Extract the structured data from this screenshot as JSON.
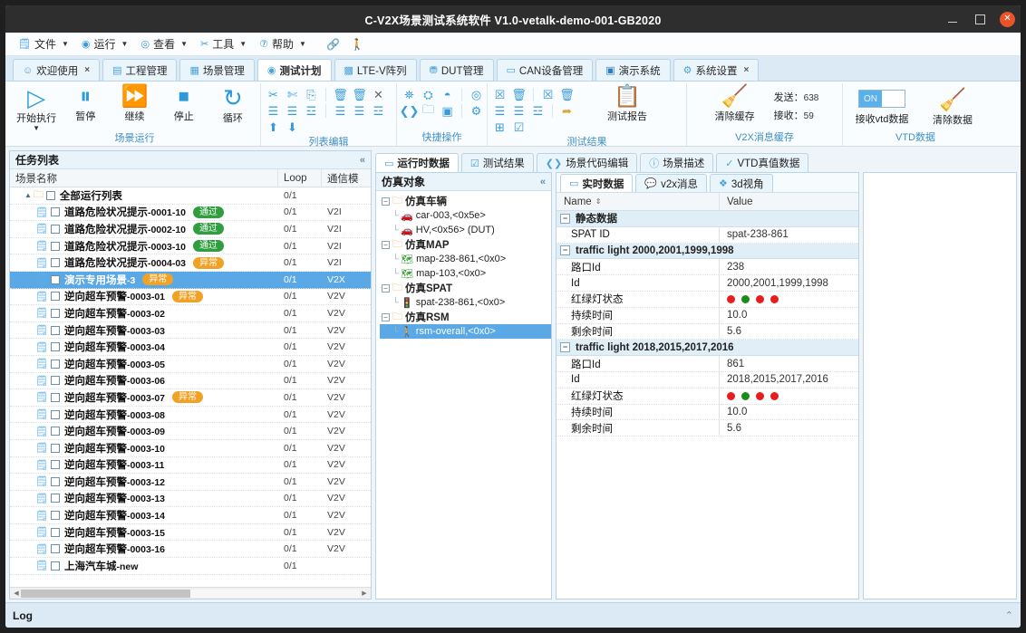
{
  "window": {
    "title": "C-V2X场景测试系统软件 V1.0-vetalk-demo-001-GB2020",
    "minimize": "—",
    "maximize": "□",
    "close": "✕"
  },
  "menubar": {
    "items": [
      {
        "label": "文件",
        "icon": "file-icon"
      },
      {
        "label": "运行",
        "icon": "run-icon"
      },
      {
        "label": "查看",
        "icon": "view-icon"
      },
      {
        "label": "工具",
        "icon": "tools-icon"
      },
      {
        "label": "帮助",
        "icon": "help-icon"
      }
    ],
    "extra": [
      {
        "icon": "link-icon",
        "glyph": "🔗"
      },
      {
        "icon": "person-icon",
        "glyph": "🚶"
      }
    ]
  },
  "tabs": [
    {
      "label": "欢迎使用",
      "closable": true,
      "active": false,
      "icon": "smiley-icon"
    },
    {
      "label": "工程管理",
      "closable": false,
      "active": false,
      "icon": "project-icon"
    },
    {
      "label": "场景管理",
      "closable": false,
      "active": false,
      "icon": "scene-icon"
    },
    {
      "label": "测试计划",
      "closable": false,
      "active": true,
      "icon": "plan-icon"
    },
    {
      "label": "LTE-V阵列",
      "closable": false,
      "active": false,
      "icon": "grid-icon"
    },
    {
      "label": "DUT管理",
      "closable": false,
      "active": false,
      "icon": "dut-icon"
    },
    {
      "label": "CAN设备管理",
      "closable": false,
      "active": false,
      "icon": "can-icon"
    },
    {
      "label": "演示系统",
      "closable": false,
      "active": false,
      "icon": "demo-icon"
    },
    {
      "label": "系统设置",
      "closable": true,
      "active": false,
      "icon": "gear-icon"
    }
  ],
  "ribbon": {
    "groups": [
      {
        "title": "场景运行",
        "buttons": [
          {
            "label": "开始执行",
            "icon": "play-icon",
            "glyph": "▷",
            "dropdown": true
          },
          {
            "label": "暂停",
            "icon": "pause-icon",
            "glyph": "⏸"
          },
          {
            "label": "继续",
            "icon": "forward-icon",
            "glyph": "⏩"
          },
          {
            "label": "停止",
            "icon": "stop-icon",
            "glyph": "⏹"
          },
          {
            "label": "循环",
            "icon": "loop-icon",
            "glyph": "↻"
          }
        ]
      },
      {
        "title": "列表编辑"
      },
      {
        "title": "快捷操作"
      },
      {
        "title": "测试结果",
        "buttons": [
          {
            "label": "测试报告",
            "icon": "report-icon",
            "glyph": "📋"
          }
        ]
      },
      {
        "title": "V2X消息缓存",
        "buttons": [
          {
            "label": "清除缓存",
            "icon": "broom-icon",
            "glyph": "🧹"
          }
        ],
        "counters": [
          {
            "label": "发送：",
            "value": "638"
          },
          {
            "label": "接收：",
            "value": "59"
          }
        ]
      },
      {
        "title": "VTD数据",
        "toggle": {
          "label": "接收vtd数据",
          "state": "ON"
        },
        "buttons": [
          {
            "label": "清除数据",
            "icon": "broom-icon",
            "glyph": "🧹"
          }
        ]
      }
    ]
  },
  "tasklist": {
    "title": "任务列表",
    "collapse": "«",
    "columns": {
      "name": "场景名称",
      "loop": "Loop",
      "mode": "通信模"
    },
    "root": {
      "name": "全部运行列表",
      "loop": "0/1",
      "mode": ""
    },
    "rows": [
      {
        "name": "道路危险状况提示",
        "suffix": "-0001-10",
        "badge": "通过",
        "badge_type": "pass",
        "loop": "0/1",
        "mode": "V2I",
        "selected": false
      },
      {
        "name": "道路危险状况提示",
        "suffix": "-0002-10",
        "badge": "通过",
        "badge_type": "pass",
        "loop": "0/1",
        "mode": "V2I",
        "selected": false
      },
      {
        "name": "道路危险状况提示",
        "suffix": "-0003-10",
        "badge": "通过",
        "badge_type": "pass",
        "loop": "0/1",
        "mode": "V2I",
        "selected": false
      },
      {
        "name": "道路危险状况提示",
        "suffix": "-0004-03",
        "badge": "异常",
        "badge_type": "err",
        "loop": "0/1",
        "mode": "V2I",
        "selected": false
      },
      {
        "name": "演示专用场景",
        "suffix": "-3",
        "badge": "异常",
        "badge_type": "err",
        "loop": "0/1",
        "mode": "V2X",
        "selected": true
      },
      {
        "name": "逆向超车预警",
        "suffix": "-0003-01",
        "badge": "异常",
        "badge_type": "err",
        "loop": "0/1",
        "mode": "V2V",
        "selected": false
      },
      {
        "name": "逆向超车预警",
        "suffix": "-0003-02",
        "badge": "",
        "badge_type": "",
        "loop": "0/1",
        "mode": "V2V",
        "selected": false
      },
      {
        "name": "逆向超车预警",
        "suffix": "-0003-03",
        "badge": "",
        "badge_type": "",
        "loop": "0/1",
        "mode": "V2V",
        "selected": false
      },
      {
        "name": "逆向超车预警",
        "suffix": "-0003-04",
        "badge": "",
        "badge_type": "",
        "loop": "0/1",
        "mode": "V2V",
        "selected": false
      },
      {
        "name": "逆向超车预警",
        "suffix": "-0003-05",
        "badge": "",
        "badge_type": "",
        "loop": "0/1",
        "mode": "V2V",
        "selected": false
      },
      {
        "name": "逆向超车预警",
        "suffix": "-0003-06",
        "badge": "",
        "badge_type": "",
        "loop": "0/1",
        "mode": "V2V",
        "selected": false
      },
      {
        "name": "逆向超车预警",
        "suffix": "-0003-07",
        "badge": "异常",
        "badge_type": "err",
        "loop": "0/1",
        "mode": "V2V",
        "selected": false
      },
      {
        "name": "逆向超车预警",
        "suffix": "-0003-08",
        "badge": "",
        "badge_type": "",
        "loop": "0/1",
        "mode": "V2V",
        "selected": false
      },
      {
        "name": "逆向超车预警",
        "suffix": "-0003-09",
        "badge": "",
        "badge_type": "",
        "loop": "0/1",
        "mode": "V2V",
        "selected": false
      },
      {
        "name": "逆向超车预警",
        "suffix": "-0003-10",
        "badge": "",
        "badge_type": "",
        "loop": "0/1",
        "mode": "V2V",
        "selected": false
      },
      {
        "name": "逆向超车预警",
        "suffix": "-0003-11",
        "badge": "",
        "badge_type": "",
        "loop": "0/1",
        "mode": "V2V",
        "selected": false
      },
      {
        "name": "逆向超车预警",
        "suffix": "-0003-12",
        "badge": "",
        "badge_type": "",
        "loop": "0/1",
        "mode": "V2V",
        "selected": false
      },
      {
        "name": "逆向超车预警",
        "suffix": "-0003-13",
        "badge": "",
        "badge_type": "",
        "loop": "0/1",
        "mode": "V2V",
        "selected": false
      },
      {
        "name": "逆向超车预警",
        "suffix": "-0003-14",
        "badge": "",
        "badge_type": "",
        "loop": "0/1",
        "mode": "V2V",
        "selected": false
      },
      {
        "name": "逆向超车预警",
        "suffix": "-0003-15",
        "badge": "",
        "badge_type": "",
        "loop": "0/1",
        "mode": "V2V",
        "selected": false
      },
      {
        "name": "逆向超车预警",
        "suffix": "-0003-16",
        "badge": "",
        "badge_type": "",
        "loop": "0/1",
        "mode": "V2V",
        "selected": false
      },
      {
        "name": "上海汽车城",
        "suffix": "-new",
        "badge": "",
        "badge_type": "",
        "loop": "0/1",
        "mode": "",
        "selected": false
      }
    ]
  },
  "simobj": {
    "title": "仿真对象",
    "collapse": "«",
    "nodes": [
      {
        "type": "group",
        "label": "仿真车辆",
        "icon": "folder-icon"
      },
      {
        "type": "leaf",
        "label": "car-003,<0x5e>",
        "icon": "car-icon",
        "selected": false
      },
      {
        "type": "leaf",
        "label": "HV,<0x56> (DUT)",
        "icon": "car-icon",
        "selected": false
      },
      {
        "type": "group",
        "label": "仿真MAP",
        "icon": "folder-icon"
      },
      {
        "type": "leaf",
        "label": "map-238-861,<0x0>",
        "icon": "map-icon",
        "selected": false
      },
      {
        "type": "leaf",
        "label": "map-103,<0x0>",
        "icon": "map-icon",
        "selected": false
      },
      {
        "type": "group",
        "label": "仿真SPAT",
        "icon": "folder-icon"
      },
      {
        "type": "leaf",
        "label": "spat-238-861,<0x0>",
        "icon": "trafficlight-icon",
        "selected": false
      },
      {
        "type": "group",
        "label": "仿真RSM",
        "icon": "folder-icon"
      },
      {
        "type": "leaf",
        "label": "rsm-overall,<0x0>",
        "icon": "pedestrian-icon",
        "selected": true
      }
    ]
  },
  "inner_tabs": [
    {
      "label": "运行时数据",
      "active": true,
      "icon": "runtime-icon"
    },
    {
      "label": "测试结果",
      "active": false,
      "icon": "result-icon"
    },
    {
      "label": "场景代码编辑",
      "active": false,
      "icon": "code-icon"
    },
    {
      "label": "场景描述",
      "active": false,
      "icon": "info-icon"
    },
    {
      "label": "VTD真值数据",
      "active": false,
      "icon": "vtd-icon"
    }
  ],
  "sub_tabs": [
    {
      "label": "实时数据",
      "active": true,
      "icon": "realtime-icon"
    },
    {
      "label": "v2x消息",
      "active": false,
      "icon": "message-icon"
    },
    {
      "label": "3d视角",
      "active": false,
      "icon": "cube-icon"
    }
  ],
  "datatable": {
    "columns": {
      "name": "Name",
      "value": "Value"
    },
    "sort_glyph": "⇕",
    "groups": [
      {
        "label": "静态数据",
        "rows": [
          {
            "key": "SPAT ID",
            "value": "spat-238-861",
            "type": "text"
          }
        ]
      },
      {
        "label": "traffic light 2000,2001,1999,1998",
        "rows": [
          {
            "key": "路口Id",
            "value": "238",
            "type": "text"
          },
          {
            "key": "Id",
            "value": "2000,2001,1999,1998",
            "type": "text"
          },
          {
            "key": "红绿灯状态",
            "value": "",
            "type": "lights",
            "lights": [
              "#e81c1c",
              "#1a8c1a",
              "#e81c1c",
              "#e81c1c"
            ]
          },
          {
            "key": "持续时间",
            "value": "10.0",
            "type": "text"
          },
          {
            "key": "剩余时间",
            "value": "5.6",
            "type": "text"
          }
        ]
      },
      {
        "label": "traffic light 2018,2015,2017,2016",
        "rows": [
          {
            "key": "路口Id",
            "value": "861",
            "type": "text"
          },
          {
            "key": "Id",
            "value": "2018,2015,2017,2016",
            "type": "text"
          },
          {
            "key": "红绿灯状态",
            "value": "",
            "type": "lights",
            "lights": [
              "#e81c1c",
              "#1a8c1a",
              "#e81c1c",
              "#e81c1c"
            ]
          },
          {
            "key": "持续时间",
            "value": "10.0",
            "type": "text"
          },
          {
            "key": "剩余时间",
            "value": "5.6",
            "type": "text"
          }
        ]
      }
    ]
  },
  "logbar": {
    "label": "Log",
    "chevron": "⌃"
  },
  "colors": {
    "accent": "#3a9bdc",
    "select": "#5aa9e6",
    "pass": "#2f9e3f",
    "error": "#f0a226",
    "titlebar": "#2e2e2e"
  }
}
